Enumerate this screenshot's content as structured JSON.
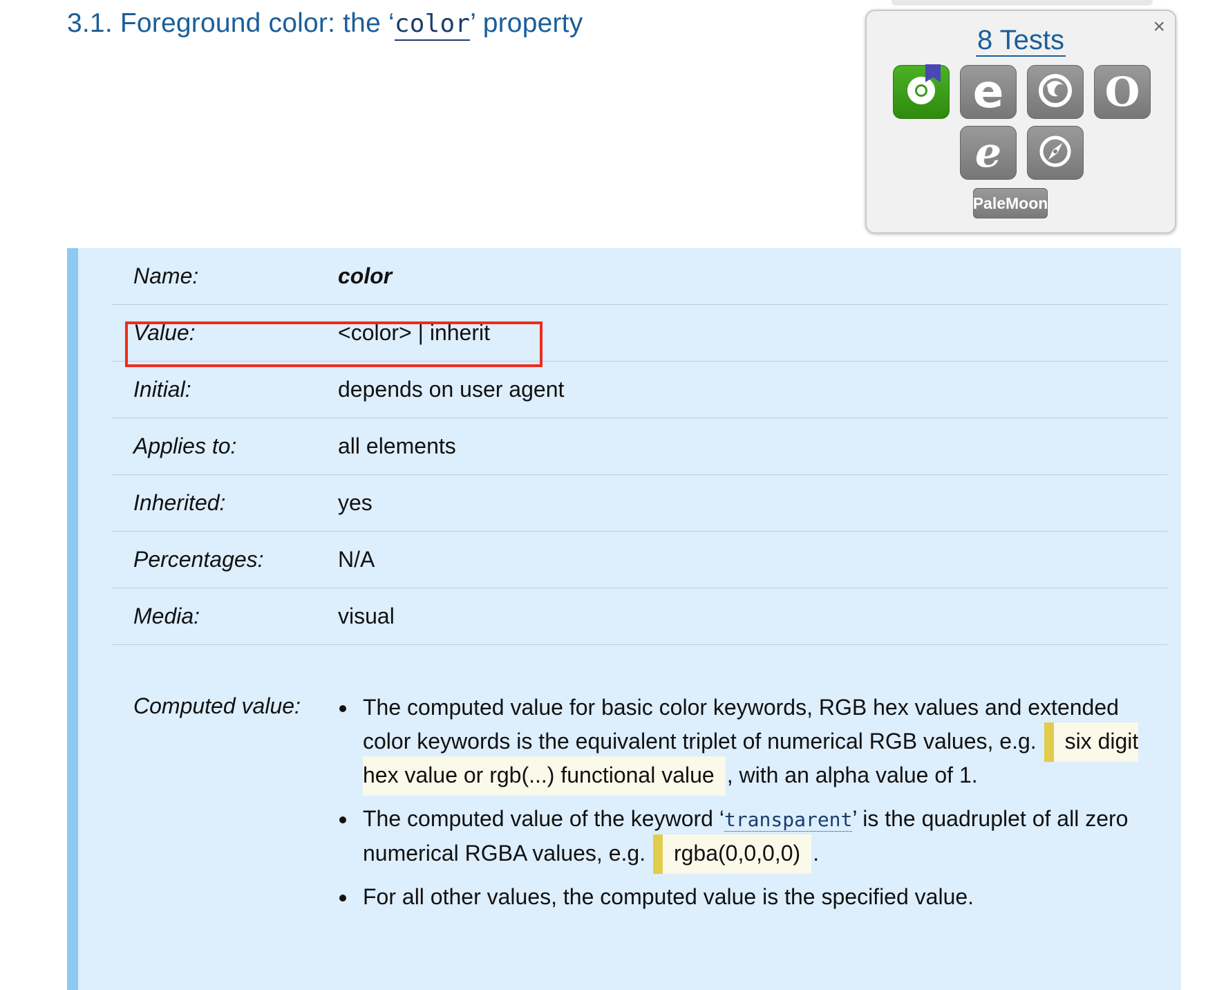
{
  "heading": {
    "prefix": "3.1. Foreground color: the ",
    "open_quote": "‘",
    "code": "color",
    "close_quote": "’",
    "suffix": " property"
  },
  "tests_panel": {
    "title": "8 Tests",
    "close": "×",
    "browsers": [
      {
        "icon": "chrome-icon",
        "glyph": "",
        "status": "pass"
      },
      {
        "icon": "edge-icon",
        "glyph": "e",
        "status": "unknown"
      },
      {
        "icon": "firefox-icon",
        "glyph": "",
        "status": "unknown"
      },
      {
        "icon": "opera-icon",
        "glyph": "O",
        "status": "unknown"
      },
      {
        "icon": "ie-icon",
        "glyph": "e",
        "status": "unknown"
      },
      {
        "icon": "safari-icon",
        "glyph": "",
        "status": "unknown"
      }
    ],
    "extra_label": "PaleMoon"
  },
  "propdef": {
    "rows": [
      {
        "key": "Name:",
        "value": "color"
      },
      {
        "key": "Value:",
        "value": "<color> | inherit"
      },
      {
        "key": "Initial:",
        "value": "depends on user agent"
      },
      {
        "key": "Applies to:",
        "value": "all elements"
      },
      {
        "key": "Inherited:",
        "value": "yes"
      },
      {
        "key": "Percentages:",
        "value": "N/A"
      },
      {
        "key": "Media:",
        "value": "visual"
      }
    ],
    "computed_key": "Computed value:",
    "bullets": {
      "b1_text_a": "The computed value for basic color keywords, RGB hex values and extended color keywords is the equivalent triplet of numerical RGB values, e.g. ",
      "b1_highlight": "six digit hex value or rgb(...) functional value",
      "b1_text_b": ", with an alpha value of 1.",
      "b2_text_a": "The computed value of the keyword ‘",
      "b2_keyword": "transparent",
      "b2_text_b": "’ is the quadruplet of all zero numerical RGBA values, e.g. ",
      "b2_highlight": "rgba(0,0,0,0)",
      "b2_text_c": ".",
      "b3_text": "For all other values, the computed value is the specified value."
    }
  },
  "colors": {
    "link": "#1a5e9a",
    "propdef_bg": "#ddeefc",
    "propdef_border": "#8ec9f2",
    "pass": "#3a9a18",
    "highlight_box": "#ee2b1c",
    "note_bar": "#e2cc4c"
  }
}
